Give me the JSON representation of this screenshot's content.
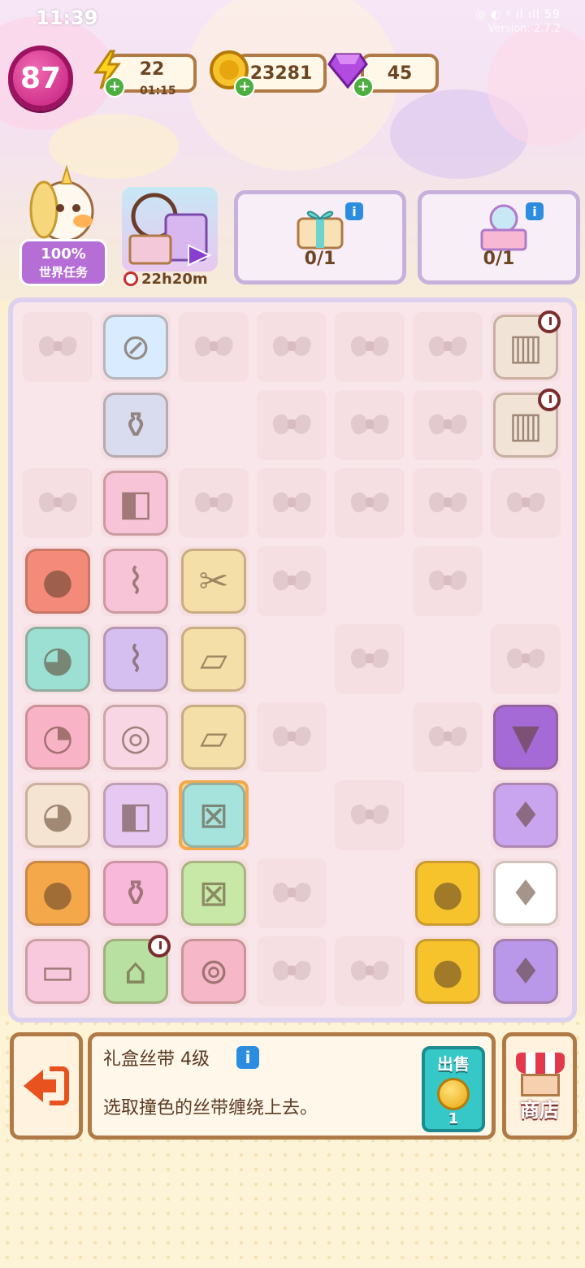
{
  "status_bar": {
    "time": "11:39",
    "right": "◎ ◐ ᵍ ıl ıll 59",
    "version": "Version: 2.7.2"
  },
  "header": {
    "level": "87",
    "energy": {
      "value": "22",
      "timer": "01:15",
      "icon": "lightning-icon"
    },
    "coins": {
      "value": "23281",
      "icon": "coin-icon"
    },
    "gems": {
      "value": "45",
      "icon": "gem-icon"
    }
  },
  "world_task": {
    "percent": "100%",
    "label": "世界任务"
  },
  "event": {
    "timer": "22h20m"
  },
  "orders": [
    {
      "count": "0/1",
      "item": "gift-box-ribbon"
    },
    {
      "count": "0/1",
      "item": "vanity-table"
    }
  ],
  "board": {
    "rows": [
      [
        "bow",
        "mirror",
        "bow",
        "bow",
        "bow",
        "bow",
        "wardrobe"
      ],
      [
        "empty",
        "lotion-bottles",
        "empty",
        "bow",
        "bow",
        "bow",
        "wardrobe"
      ],
      [
        "bow",
        "makeup-palette",
        "bow",
        "bow",
        "bow",
        "bow",
        "bow"
      ],
      [
        "hamster",
        "lint-roller",
        "cardboard-scissors",
        "bow",
        "empty",
        "bow",
        "empty"
      ],
      [
        "seal-plush",
        "makeup-brushes",
        "gift-box-folded",
        "empty",
        "bow",
        "empty",
        "bow"
      ],
      [
        "bunny-plush",
        "powder-compact",
        "gift-box-open",
        "bow",
        "empty",
        "bow",
        "skirt"
      ],
      [
        "puppy-plush",
        "blush-compact",
        "gift-box-ribbon",
        "empty",
        "bow",
        "empty",
        "dress-purple"
      ],
      [
        "tiger-plush",
        "perfume-bottle",
        "gift-box-wrapped",
        "bow",
        "empty",
        "coins-small",
        "dress-white"
      ],
      [
        "bed-generator",
        "house-generator",
        "balloons-generator",
        "bow",
        "bow",
        "coins-pile",
        "dress-gown"
      ]
    ]
  },
  "selected_item": {
    "title": "礼盒丝带 4级",
    "description": "选取撞色的丝带缠绕上去。",
    "sell_label": "出售",
    "sell_price": "1"
  },
  "shop_label": "商店",
  "colors": {
    "accent": "#b07a46",
    "board_border": "#ddd1f0",
    "sell": "#36c7c7"
  }
}
